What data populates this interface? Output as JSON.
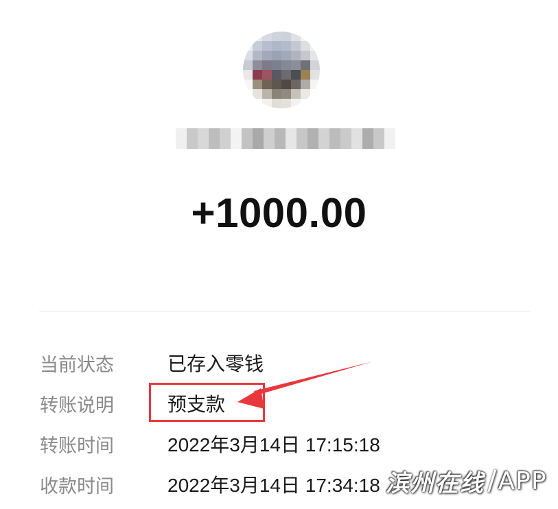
{
  "transfer": {
    "amount": "+1000.00",
    "details": [
      {
        "label": "当前状态",
        "value": "已存入零钱"
      },
      {
        "label": "转账说明",
        "value": "预支款"
      },
      {
        "label": "转账时间",
        "value": "2022年3月14日 17:15:18"
      },
      {
        "label": "收款时间",
        "value": "2022年3月14日 17:34:18"
      }
    ]
  },
  "annotation": {
    "highlight_color": "#e8383d",
    "highlighted_field": "转账说明"
  },
  "watermark": {
    "text": "滨州在线",
    "separator": "/",
    "app": "APP"
  }
}
